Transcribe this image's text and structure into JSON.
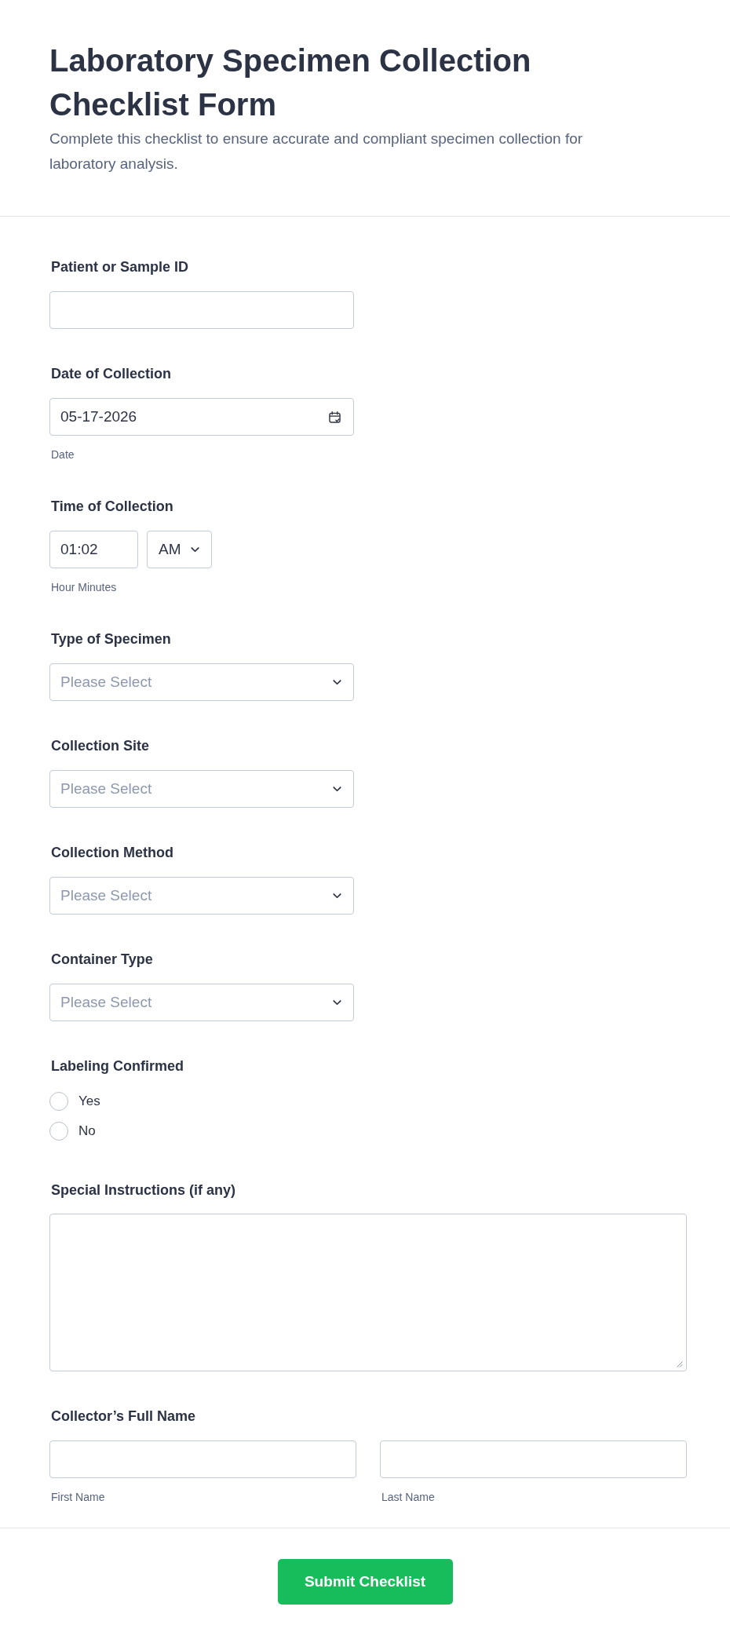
{
  "form": {
    "title": "Laboratory Specimen Collection Checklist Form",
    "description": "Complete this checklist to ensure accurate and compliant specimen collection for laboratory analysis."
  },
  "fields": [
    {
      "kind": "text",
      "label": "Patient or Sample ID"
    },
    {
      "kind": "date",
      "label": "Date of Collection",
      "value": "05-17-2026",
      "sublabel": "Date"
    },
    {
      "kind": "time",
      "label": "Time of Collection",
      "value": "01:02",
      "period": "AM",
      "sublabel": "Hour Minutes"
    },
    {
      "kind": "select",
      "label": "Type of Specimen",
      "placeholder": "Please Select"
    },
    {
      "kind": "select",
      "label": "Collection Site",
      "placeholder": "Please Select"
    },
    {
      "kind": "select",
      "label": "Collection Method",
      "placeholder": "Please Select"
    },
    {
      "kind": "select",
      "label": "Container Type",
      "placeholder": "Please Select"
    },
    {
      "kind": "radio",
      "label": "Labeling Confirmed",
      "options": [
        {
          "label": "Yes",
          "selected": false
        },
        {
          "label": "No",
          "selected": false
        }
      ]
    },
    {
      "kind": "textarea",
      "label": "Special Instructions (if any)"
    },
    {
      "kind": "name",
      "label": "Collector’s Full Name",
      "parts": [
        {
          "sublabel": "First Name"
        },
        {
          "sublabel": "Last Name"
        }
      ]
    }
  ],
  "submit": {
    "label": "Submit Checklist"
  }
}
